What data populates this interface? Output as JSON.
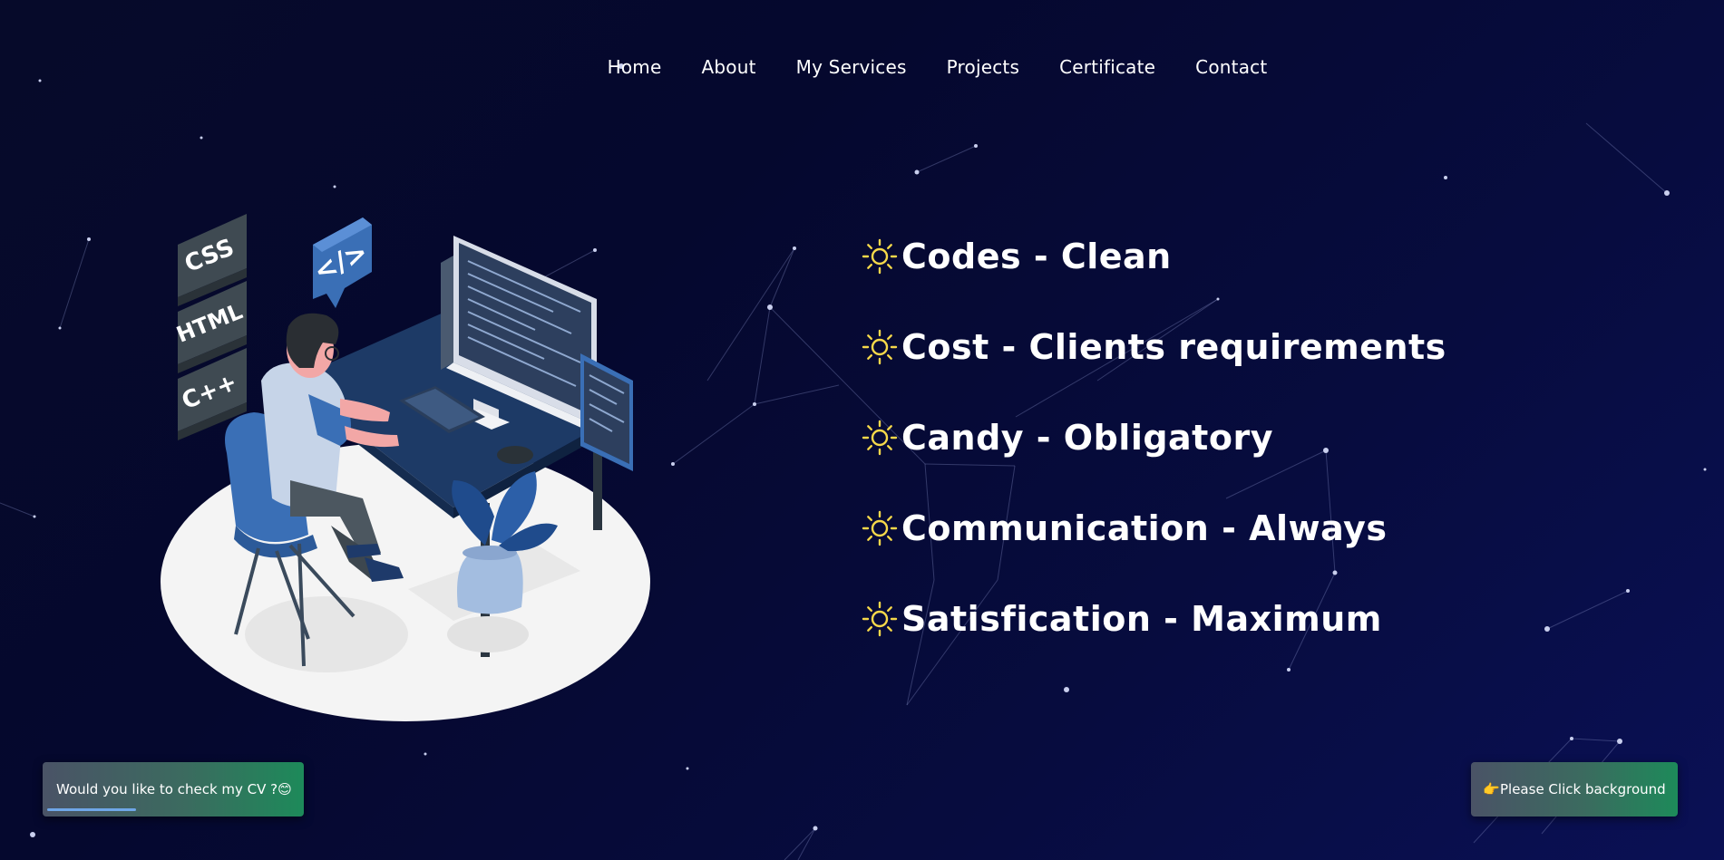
{
  "nav": {
    "items": [
      {
        "label": "Home"
      },
      {
        "label": "About"
      },
      {
        "label": "My Services"
      },
      {
        "label": "Projects"
      },
      {
        "label": "Certificate"
      },
      {
        "label": "Contact"
      }
    ]
  },
  "illustration": {
    "badges": [
      "CSS",
      "HTML",
      "C++"
    ],
    "code_bubble": "</>"
  },
  "features": [
    {
      "icon": "sun-icon",
      "label": "Codes - Clean"
    },
    {
      "icon": "sun-icon",
      "label": "Cost - Clients requirements"
    },
    {
      "icon": "sun-icon",
      "label": "Candy - Obligatory"
    },
    {
      "icon": "sun-icon",
      "label": "Communication - Always"
    },
    {
      "icon": "sun-icon",
      "label": "Satisfication - Maximum"
    }
  ],
  "toasts": {
    "cv": "Would you like to check my CV ?😊",
    "background": "👉Please Click background"
  },
  "colors": {
    "background": "#05082e",
    "sun": "#f5d84a",
    "toast_green": "#1d8a5a",
    "toast_gray": "#4a5366",
    "progress": "#6fa7e8"
  }
}
